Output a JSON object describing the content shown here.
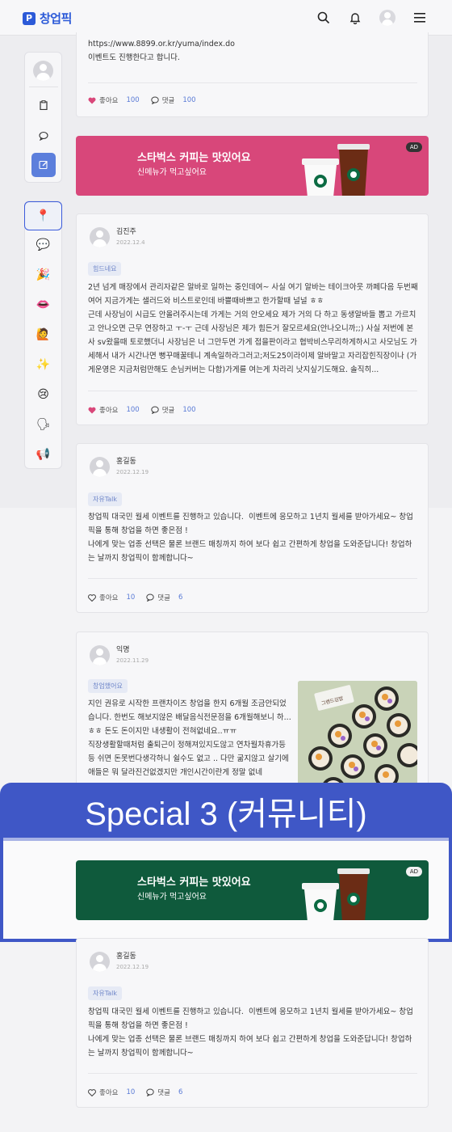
{
  "header": {
    "logo_mark": "P",
    "logo_text": "창업픽",
    "icons": [
      "search-icon",
      "bell-icon",
      "avatar",
      "menu-icon"
    ]
  },
  "sidebar": {
    "actions": [
      "clipboard-icon",
      "comment-icon",
      "edit-icon"
    ],
    "categories": [
      "pin-icon",
      "speech-balloon-icon",
      "party-popper-icon",
      "lips-icon",
      "person-icon",
      "sparkles-icon",
      "sad-face-icon",
      "speaking-head-icon",
      "megaphone-icon"
    ],
    "category_glyphs": [
      "📍",
      "💬",
      "🎉",
      "👄",
      "🙋",
      "✨",
      "😢",
      "🗣",
      "📢"
    ]
  },
  "post0": {
    "body": "https://www.8899.or.kr/yuma/index.do\n이벤트도 진행한다고 합니다.",
    "like_label": "좋아요",
    "like_count": "100",
    "comment_label": "댓글",
    "comment_count": "100"
  },
  "ad1": {
    "title": "스타벅스 커피는 맛있어요",
    "subtitle": "신메뉴가 먹고싶어요",
    "badge": "AD",
    "color": "#d8477a"
  },
  "post1": {
    "author": "김진주",
    "date": "2022.12.4",
    "tag": "힘드네요",
    "body": "2년 넘게 매장에서 관리자같은 알바로 일하는 중인데여~ 사실 여기 알바는 테이크아웃 까페다음 두번째여어 지금가게는 샐러드와 비스트로인데 바쁠때바쁘고 한가할때 널널 ㅎㅎ\n근데 사장님이 시급도 안올려주시는데 가게는 거의 안오세요 제가 거의 다 하고 동생알바들 뽑고 가르치고 안나오면 근무 연장하고 ㅜ-ㅜ 근데 사장님은 제가 힘든거 잘모르세요(안나오니까;;) 사실 저번에 본사 sv왔을때 토로했더니 사장님은 너 그만두면 가게 접을판이라고 협박비스무리하게하시고 사모님도 가세해서 내가 시간나면 뻥꾸매꿀테니 계속일하라그러고;저도25이라이제 알바말고 자리잡힌직장이나 (가게운영은 지금처럼만해도 손님커버는 다함)가게를 여는게 차라리 낫지싶기도해요. 솔직히...",
    "like_label": "좋아요",
    "like_count": "100",
    "comment_label": "댓글",
    "comment_count": "100"
  },
  "post2": {
    "author": "홍길동",
    "date": "2022.12.19",
    "tag": "자유Talk",
    "body": "창업픽 대국민 월세 이벤트를 진행하고 있습니다.  이벤트에 응모하고 1년치 월세를 받아가세요~ 창업픽을 통해 창업을 하면 좋은점 !\n나에게 맞는 업종 선택은 물론 브랜드 매칭까지 하여 보다 쉽고 간편하게 창업을 도와준답니다! 창업하는 날까지 창업픽이 함께합니다~",
    "like_label": "좋아요",
    "like_count": "10",
    "comment_label": "댓글",
    "comment_count": "6"
  },
  "post3": {
    "author": "익명",
    "date": "2022.11.29",
    "tag": "창업했어요",
    "body": "지인 권유로 시작한 프랜차이즈 창업을 한지 6개월 조금안되었습니다. 한번도 해보지않은 배달음식전문점을 6개월해보니 하...ㅎㅎ 돈도 돈이지만 내생활이 전혀없네요..ㅠㅠ\n직장생활할때처럼 출퇴근이 정해져있지도않고 연차월차휴가등등 쉬면 돈못번다생각하니 쉴수도 없고 .. 다만 굶지않고 살기에 애들은 뭐 달라진건없겠지만 개인시간이란게 정말 없네",
    "image_sign": "그랜드김밥"
  },
  "banner": {
    "text": "Special 3 (커뮤니티)"
  },
  "ad2": {
    "title": "스타벅스 커피는 맛있어요",
    "subtitle": "신메뉴가 먹고싶어요",
    "badge": "AD",
    "color": "#0f5a3c"
  },
  "post4": {
    "author": "홍길동",
    "date": "2022.12.19",
    "tag": "자유Talk",
    "body": "창업픽 대국민 월세 이벤트를 진행하고 있습니다.  이벤트에 응모하고 1년치 월세를 받아가세요~ 창업픽을 통해 창업을 하면 좋은점 !\n나에게 맞는 업종 선택은 물론 브랜드 매칭까지 하여 보다 쉽고 간편하게 창업을 도와준답니다! 창업하는 날까지 창업픽이 함께합니다~",
    "like_label": "좋아요",
    "like_count": "10",
    "comment_label": "댓글",
    "comment_count": "6"
  }
}
